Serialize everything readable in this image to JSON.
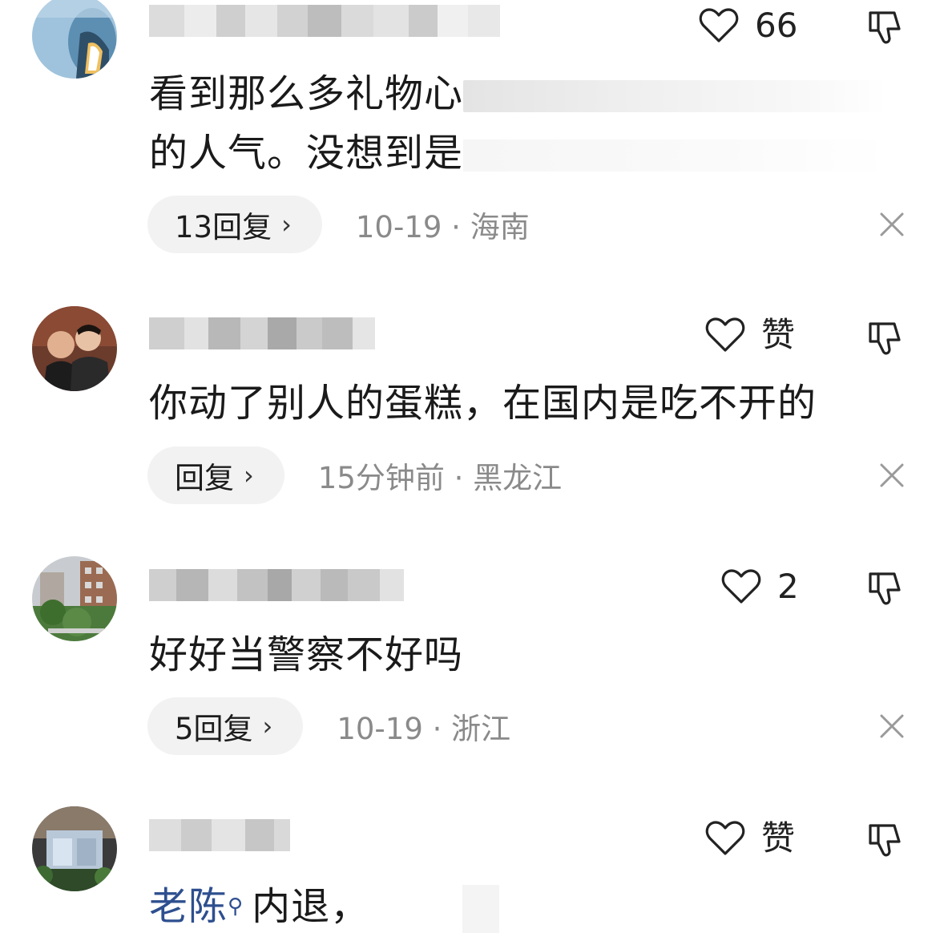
{
  "comments": [
    {
      "likes": "66",
      "lines": [
        "看到那么多礼物心",
        "的人气。没想到是"
      ],
      "replies": "13回复",
      "time": "10-19",
      "location": "海南"
    },
    {
      "likes": "赞",
      "lines": [
        "你动了别人的蛋糕，在国内是吃不开的"
      ],
      "replies": "回复",
      "time": "15分钟前",
      "location": "黑龙江"
    },
    {
      "likes": "2",
      "lines": [
        "好好当警察不好吗"
      ],
      "replies": "5回复",
      "time": "10-19",
      "location": "浙江"
    },
    {
      "likes": "赞",
      "mention": "老陈",
      "text_after_mention": "内退，"
    }
  ],
  "separator": "·",
  "icons": {
    "like": "heart-outline-icon",
    "dislike": "thumbs-down-icon",
    "close": "close-icon",
    "chevron": "chevron-right-icon",
    "mention_marker": "search-mark-icon"
  },
  "colors": {
    "text": "#1a1a1a",
    "meta": "#8a8a8a",
    "pill_bg": "#f2f2f2",
    "mention": "#2e4f8f"
  }
}
